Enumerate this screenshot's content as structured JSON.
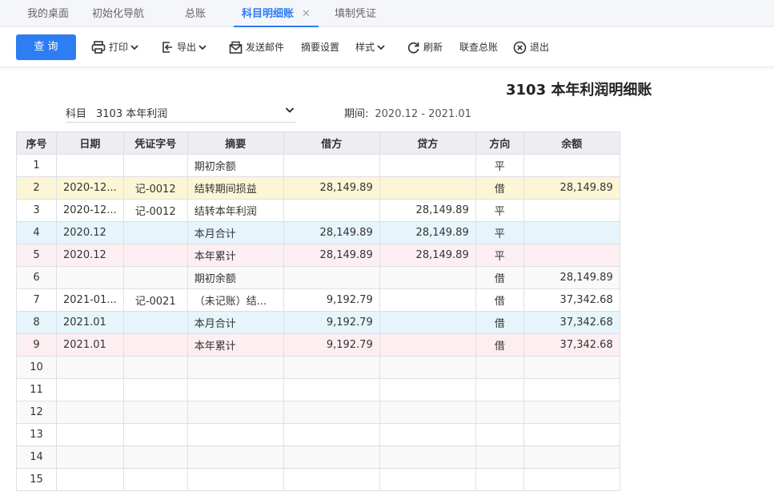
{
  "tabs": [
    {
      "label": "我的桌面",
      "active": false
    },
    {
      "label": "初始化导航",
      "active": false
    },
    {
      "label": "总账",
      "active": false
    },
    {
      "label": "科目明细账",
      "active": true
    },
    {
      "label": "填制凭证",
      "active": false
    }
  ],
  "toolbar": {
    "query_label": "查 询",
    "print_label": "打印",
    "export_label": "导出",
    "email_label": "发送邮件",
    "summary_label": "摘要设置",
    "style_label": "样式",
    "refresh_label": "刷新",
    "link_label": "联查总账",
    "exit_label": "退出"
  },
  "report": {
    "title": "3103 本年利润明细账",
    "subject_label": "科目",
    "subject_value": "3103 本年利润",
    "period_label": "期间:",
    "period_value": "2020.12 - 2021.01"
  },
  "table": {
    "headers": [
      "序号",
      "日期",
      "凭证字号",
      "摘要",
      "借方",
      "贷方",
      "方向",
      "余额"
    ],
    "rows": [
      {
        "no": "1",
        "date": "",
        "voucher": "",
        "summary": "期初余额",
        "debit": "",
        "credit": "",
        "dir": "平",
        "balance": "",
        "style": "white"
      },
      {
        "no": "2",
        "date": "2020-12...",
        "voucher": "记-0012",
        "summary": "结转期间损益",
        "debit": "28,149.89",
        "credit": "",
        "dir": "借",
        "balance": "28,149.89",
        "style": "yellow"
      },
      {
        "no": "3",
        "date": "2020-12...",
        "voucher": "记-0012",
        "summary": "结转本年利润",
        "debit": "",
        "credit": "28,149.89",
        "dir": "平",
        "balance": "",
        "style": "white"
      },
      {
        "no": "4",
        "date": "2020.12",
        "voucher": "",
        "summary": "本月合计",
        "debit": "28,149.89",
        "credit": "28,149.89",
        "dir": "平",
        "balance": "",
        "style": "blue"
      },
      {
        "no": "5",
        "date": "2020.12",
        "voucher": "",
        "summary": "本年累计",
        "debit": "28,149.89",
        "credit": "28,149.89",
        "dir": "平",
        "balance": "",
        "style": "pink"
      },
      {
        "no": "6",
        "date": "",
        "voucher": "",
        "summary": "期初余额",
        "debit": "",
        "credit": "",
        "dir": "借",
        "balance": "28,149.89",
        "style": "grey"
      },
      {
        "no": "7",
        "date": "2021-01...",
        "voucher": "记-0021",
        "summary": "（未记账）结...",
        "debit": "9,192.79",
        "credit": "",
        "dir": "借",
        "balance": "37,342.68",
        "style": "white"
      },
      {
        "no": "8",
        "date": "2021.01",
        "voucher": "",
        "summary": "本月合计",
        "debit": "9,192.79",
        "credit": "",
        "dir": "借",
        "balance": "37,342.68",
        "style": "blue"
      },
      {
        "no": "9",
        "date": "2021.01",
        "voucher": "",
        "summary": "本年累计",
        "debit": "9,192.79",
        "credit": "",
        "dir": "借",
        "balance": "37,342.68",
        "style": "pink"
      },
      {
        "no": "10",
        "date": "",
        "voucher": "",
        "summary": "",
        "debit": "",
        "credit": "",
        "dir": "",
        "balance": "",
        "style": "grey"
      },
      {
        "no": "11",
        "date": "",
        "voucher": "",
        "summary": "",
        "debit": "",
        "credit": "",
        "dir": "",
        "balance": "",
        "style": "white"
      },
      {
        "no": "12",
        "date": "",
        "voucher": "",
        "summary": "",
        "debit": "",
        "credit": "",
        "dir": "",
        "balance": "",
        "style": "grey"
      },
      {
        "no": "13",
        "date": "",
        "voucher": "",
        "summary": "",
        "debit": "",
        "credit": "",
        "dir": "",
        "balance": "",
        "style": "white"
      },
      {
        "no": "14",
        "date": "",
        "voucher": "",
        "summary": "",
        "debit": "",
        "credit": "",
        "dir": "",
        "balance": "",
        "style": "grey"
      },
      {
        "no": "15",
        "date": "",
        "voucher": "",
        "summary": "",
        "debit": "",
        "credit": "",
        "dir": "",
        "balance": "",
        "style": "white"
      }
    ]
  },
  "colors": {
    "accent": "#2d7df5",
    "voucher_link": "#2d56c8",
    "row_yellow": "#fdf6d6",
    "row_blue": "#e6f4fb",
    "row_pink": "#fdeff1"
  }
}
